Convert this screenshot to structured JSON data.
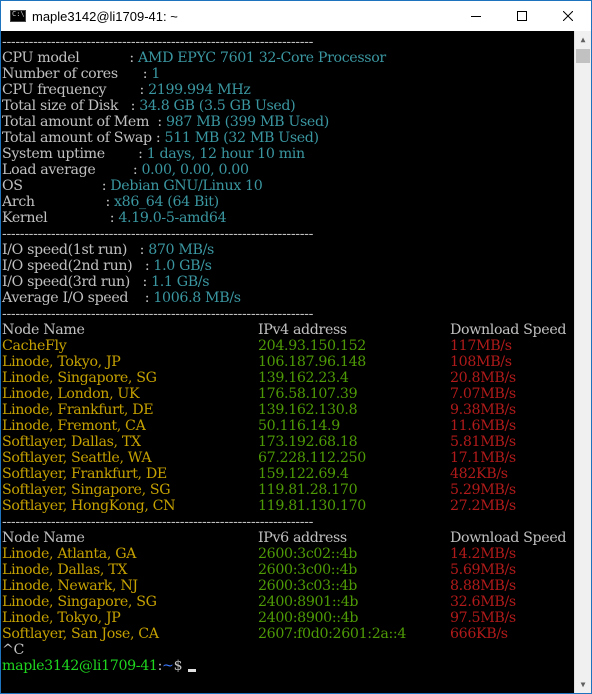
{
  "window": {
    "title": "maple3142@li1709-41: ~",
    "icon": "console-icon",
    "controls": [
      "minimize-icon",
      "maximize-icon",
      "close-icon"
    ]
  },
  "separator": "----------------------------------------------------------------------",
  "system_info": [
    {
      "label": "CPU model            ",
      "value": "AMD EPYC 7601 32-Core Processor"
    },
    {
      "label": "Number of cores      ",
      "value": "1"
    },
    {
      "label": "CPU frequency        ",
      "value": "2199.994 MHz"
    },
    {
      "label": "Total size of Disk   ",
      "value": "34.8 GB (3.5 GB Used)"
    },
    {
      "label": "Total amount of Mem  ",
      "value": "987 MB (399 MB Used)"
    },
    {
      "label": "Total amount of Swap ",
      "value": "511 MB (32 MB Used)"
    },
    {
      "label": "System uptime        ",
      "value": "1 days, 12 hour 10 min"
    },
    {
      "label": "Load average         ",
      "value": "0.00, 0.00, 0.00"
    },
    {
      "label": "OS                   ",
      "value": "Debian GNU/Linux 10"
    },
    {
      "label": "Arch                 ",
      "value": "x86_64 (64 Bit)"
    },
    {
      "label": "Kernel               ",
      "value": "4.19.0-5-amd64"
    }
  ],
  "io_speed": [
    {
      "label": "I/O speed(1st run)   ",
      "value": "870 MB/s"
    },
    {
      "label": "I/O speed(2nd run)   ",
      "value": "1.0 GB/s"
    },
    {
      "label": "I/O speed(3rd run)   ",
      "value": "1.1 GB/s"
    },
    {
      "label": "Average I/O speed    ",
      "value": "1006.8 MB/s"
    }
  ],
  "separator_colon": ": ",
  "ipv4_table": {
    "headers": [
      "Node Name",
      "IPv4 address",
      "Download Speed"
    ],
    "rows": [
      [
        "CacheFly",
        "204.93.150.152",
        "117MB/s"
      ],
      [
        "Linode, Tokyo, JP",
        "106.187.96.148",
        "108MB/s"
      ],
      [
        "Linode, Singapore, SG",
        "139.162.23.4",
        "20.8MB/s"
      ],
      [
        "Linode, London, UK",
        "176.58.107.39",
        "7.07MB/s"
      ],
      [
        "Linode, Frankfurt, DE",
        "139.162.130.8",
        "9.38MB/s"
      ],
      [
        "Linode, Fremont, CA",
        "50.116.14.9",
        "11.6MB/s"
      ],
      [
        "Softlayer, Dallas, TX",
        "173.192.68.18",
        "5.81MB/s"
      ],
      [
        "Softlayer, Seattle, WA",
        "67.228.112.250",
        "17.1MB/s"
      ],
      [
        "Softlayer, Frankfurt, DE",
        "159.122.69.4",
        "482KB/s"
      ],
      [
        "Softlayer, Singapore, SG",
        "119.81.28.170",
        "5.29MB/s"
      ],
      [
        "Softlayer, HongKong, CN",
        "119.81.130.170",
        "27.2MB/s"
      ]
    ]
  },
  "ipv6_table": {
    "headers": [
      "Node Name",
      "IPv6 address",
      "Download Speed"
    ],
    "rows": [
      [
        "Linode, Atlanta, GA",
        "2600:3c02::4b",
        "14.2MB/s"
      ],
      [
        "Linode, Dallas, TX",
        "2600:3c00::4b",
        "5.69MB/s"
      ],
      [
        "Linode, Newark, NJ",
        "2600:3c03::4b",
        "8.88MB/s"
      ],
      [
        "Linode, Singapore, SG",
        "2400:8901::4b",
        "32.6MB/s"
      ],
      [
        "Linode, Tokyo, JP",
        "2400:8900::4b",
        "97.5MB/s"
      ],
      [
        "Softlayer, San Jose, CA",
        "2607:f0d0:2601:2a::4",
        "666KB/s"
      ]
    ]
  },
  "interrupt": "^C",
  "prompt": {
    "user_host": "maple3142@li1709-41",
    "colon": ":",
    "path": "~",
    "symbol": "$ "
  },
  "colors": {
    "label": "#c0c0c0",
    "value": "#3a96a0",
    "node": "#c4a000",
    "ip": "#4e9a06",
    "speed": "#b01a1a",
    "prompt_user": "#1fd61f",
    "prompt_path": "#3b78ff"
  }
}
